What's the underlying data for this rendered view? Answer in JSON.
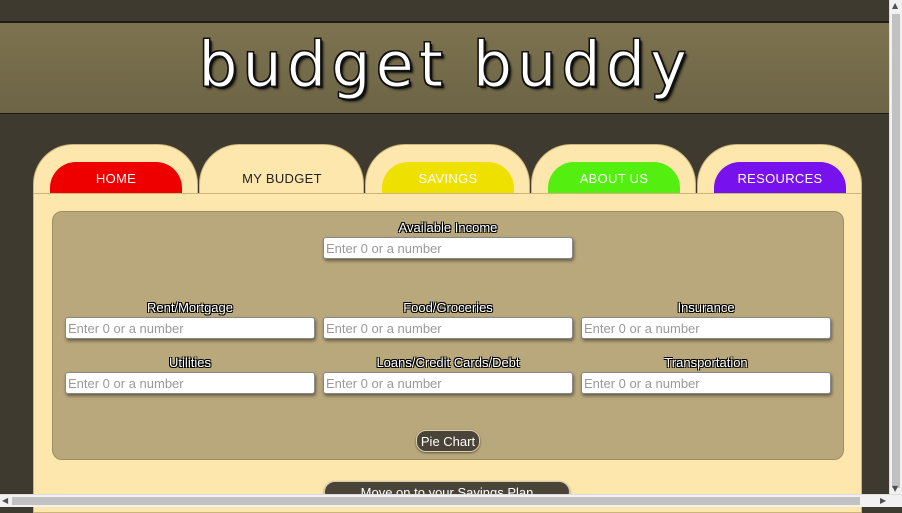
{
  "header": {
    "logo_text": "budget buddy"
  },
  "tabs": [
    {
      "label": "HOME",
      "color": "#ee0000"
    },
    {
      "label": "MY BUDGET",
      "color": "#fde7ad",
      "active": true
    },
    {
      "label": "SAVINGS",
      "color": "#eee000"
    },
    {
      "label": "ABOUT US",
      "color": "#55ee11"
    },
    {
      "label": "RESOURCES",
      "color": "#7711ee"
    }
  ],
  "form": {
    "available_income": {
      "label": "Available Income",
      "placeholder": "Enter 0 or a number"
    },
    "rent": {
      "label": "Rent/Mortgage",
      "placeholder": "Enter 0 or a number"
    },
    "food": {
      "label": "Food/Groceries",
      "placeholder": "Enter 0 or a number"
    },
    "insurance": {
      "label": "Insurance",
      "placeholder": "Enter 0 or a number"
    },
    "utilities": {
      "label": "Utilities",
      "placeholder": "Enter 0 or a number"
    },
    "loans": {
      "label": "Loans/Credit Cards/Debt",
      "placeholder": "Enter 0 or a number"
    },
    "transportation": {
      "label": "Transportation",
      "placeholder": "Enter 0 or a number"
    },
    "pie_chart_label": "Pie Chart"
  },
  "next_button_label": "Move on to your Savings Plan",
  "icons": {
    "scroll_up": "arrow-up-icon",
    "scroll_down": "arrow-down-icon",
    "scroll_left": "arrow-left-icon",
    "scroll_right": "arrow-right-icon"
  }
}
